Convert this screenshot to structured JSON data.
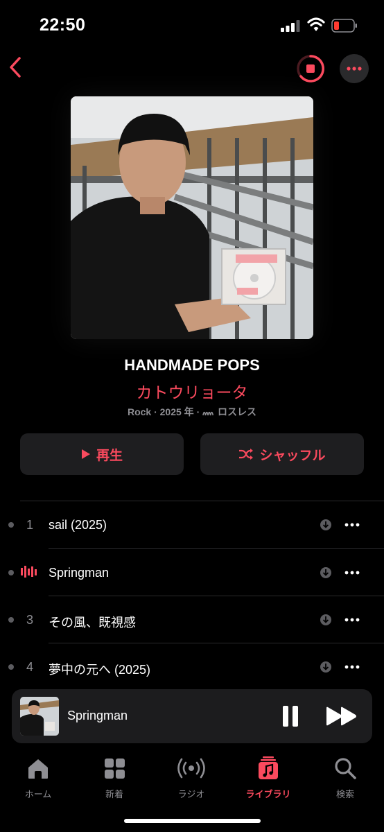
{
  "status": {
    "time": "22:50"
  },
  "album": {
    "title": "HANDMADE POPS",
    "artist": "カトウリョータ",
    "genre_year": "Rock · 2025 年 ·",
    "format": "ロスレス"
  },
  "actions": {
    "play_label": "再生",
    "shuffle_label": "シャッフル"
  },
  "tracks": [
    {
      "number": "1",
      "title": "sail (2025)",
      "playing": false
    },
    {
      "number": "",
      "title": "Springman",
      "playing": true
    },
    {
      "number": "3",
      "title": "その風、既視感",
      "playing": false
    },
    {
      "number": "4",
      "title": "夢中の元へ (2025)",
      "playing": false
    }
  ],
  "now_playing": {
    "title": "Springman"
  },
  "tabs": [
    {
      "label": "ホーム",
      "icon": "home-icon"
    },
    {
      "label": "新着",
      "icon": "grid-icon"
    },
    {
      "label": "ラジオ",
      "icon": "radio-icon"
    },
    {
      "label": "ライブラリ",
      "icon": "library-icon",
      "active": true
    },
    {
      "label": "検索",
      "icon": "search-icon"
    }
  ],
  "colors": {
    "accent": "#fb4a5e",
    "background": "#000000",
    "surface": "#1e1e20"
  }
}
